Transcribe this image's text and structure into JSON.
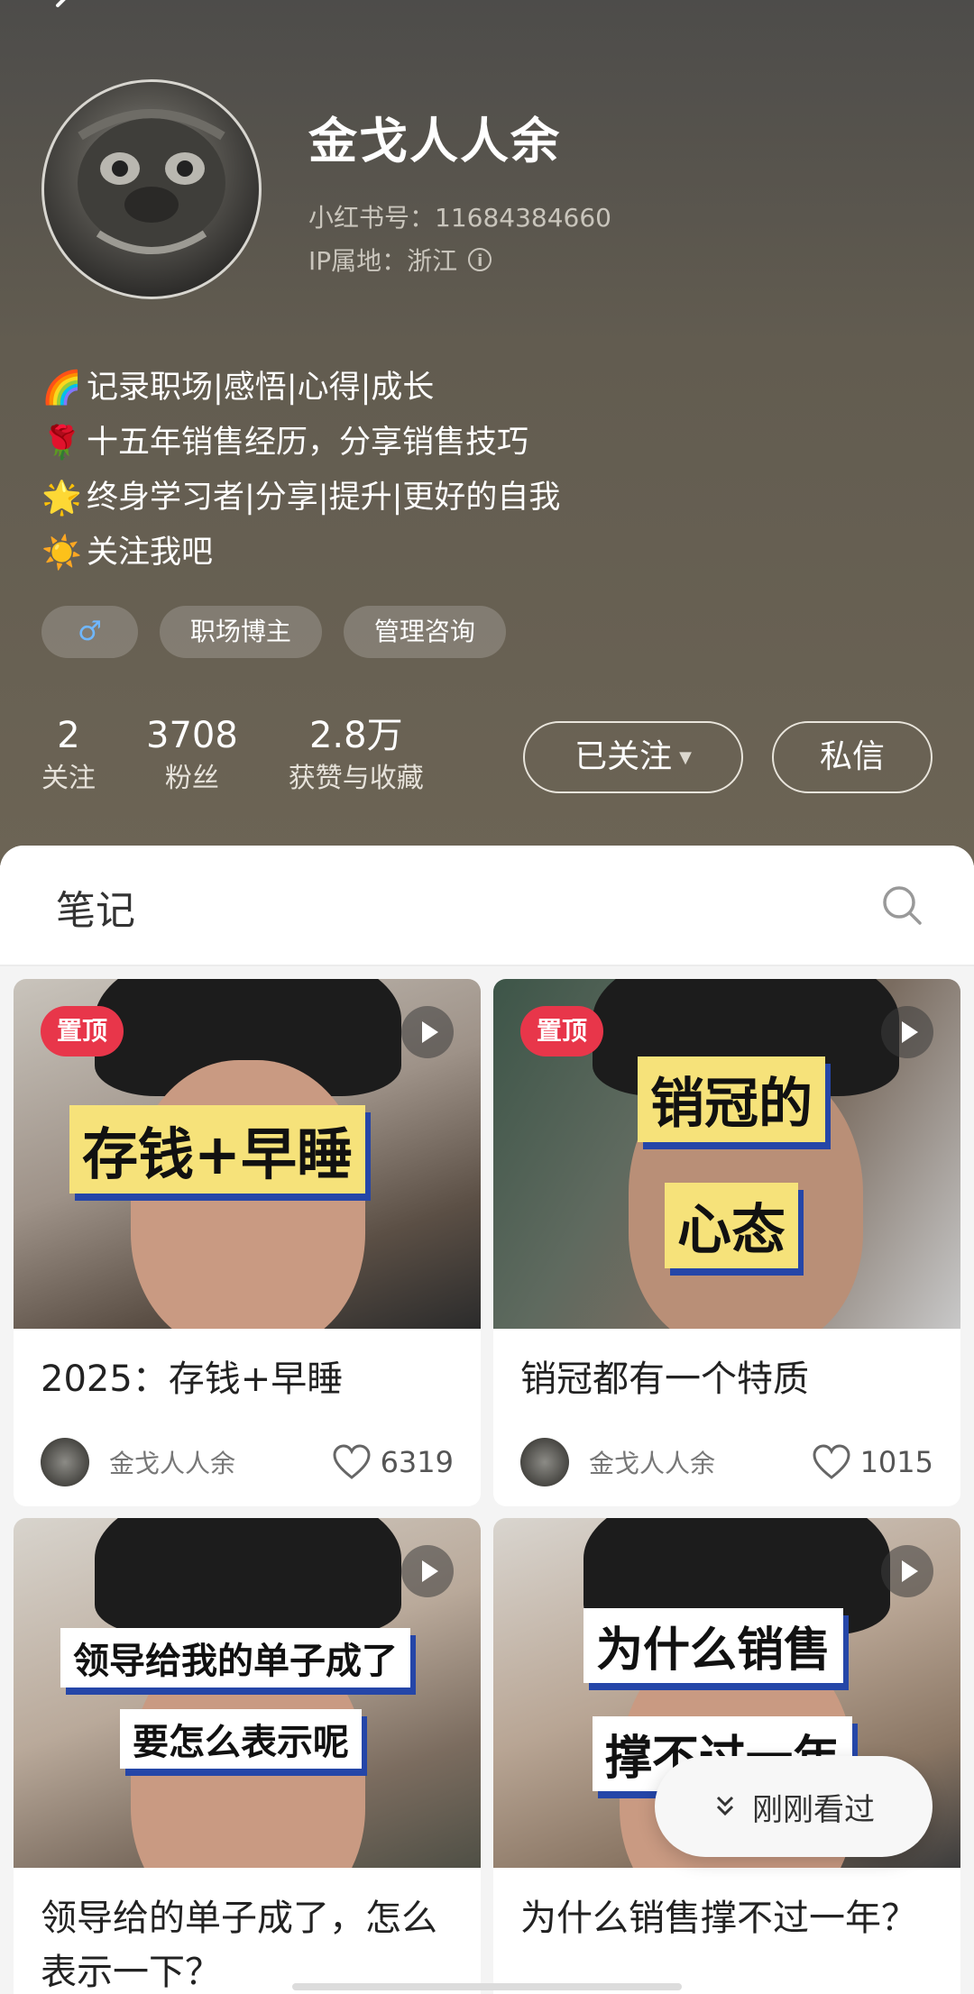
{
  "profile": {
    "nickname": "金戈人人余",
    "red_id": "小红书号：11684384660",
    "ip_location": "IP属地：浙江",
    "bio": [
      {
        "icon": "🌈",
        "text": "记录职场|感悟|心得|成长"
      },
      {
        "icon": "🌹",
        "text": "十五年销售经历，分享销售技巧"
      },
      {
        "icon": "🌟",
        "text": "终身学习者|分享|提升|更好的自我"
      },
      {
        "icon": "☀️",
        "text": "关注我吧"
      }
    ],
    "tags": {
      "gender": "♂",
      "tag1": "职场博主",
      "tag2": "管理咨询"
    },
    "stats": {
      "following": {
        "value": "2",
        "label": "关注"
      },
      "followers": {
        "value": "3708",
        "label": "粉丝"
      },
      "likes_collects": {
        "value": "2.8万",
        "label": "获赞与收藏"
      }
    },
    "follow_button": "已关注",
    "message_button": "私信"
  },
  "notes": {
    "tab_label": "笔记",
    "cards": [
      {
        "pinned": "置顶",
        "caption_lines": [
          "存钱+早睡"
        ],
        "title": "2025：存钱+早睡",
        "author": "金戈人人余",
        "likes": "6319"
      },
      {
        "pinned": "置顶",
        "caption_lines": [
          "销冠的",
          "心态"
        ],
        "title": "销冠都有一个特质",
        "author": "金戈人人余",
        "likes": "1015"
      },
      {
        "caption_lines": [
          "领导给我的单子成了",
          "要怎么表示呢"
        ],
        "title": "领导给的单子成了，怎么表示一下？"
      },
      {
        "caption_lines": [
          "为什么销售",
          "撑不过一年"
        ],
        "title": "为什么销售撑不过一年？"
      }
    ]
  },
  "recent_button": "刚刚看过",
  "colors": {
    "pin_badge": "#e8364a",
    "caption_bg": "#f6e27a",
    "caption_shadow": "#2546a8",
    "gender": "#6fb7ff"
  }
}
